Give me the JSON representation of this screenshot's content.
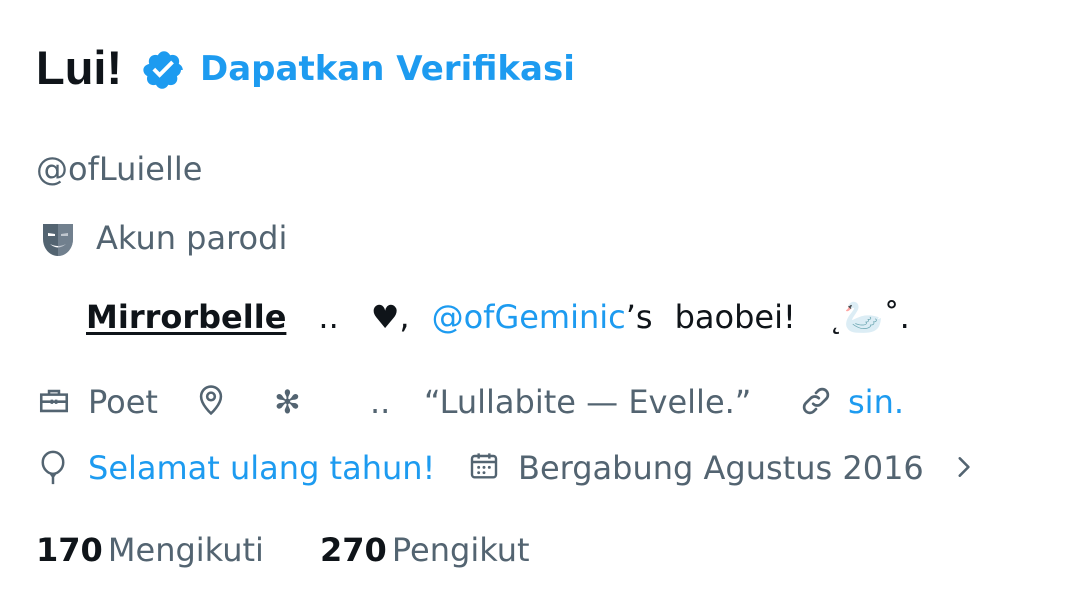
{
  "profile": {
    "display_name": "Lui!",
    "verify_cta": "Dapatkan Verifikasi",
    "handle": "@ofLuielle",
    "parody_label": "Akun parodi"
  },
  "bio": {
    "mirror": "Mirrorbelle",
    "dots1": "..",
    "heart": "♥,",
    "mention": "@ofGeminic",
    "possessive": "’s",
    "baobei": "baobei!",
    "tail_left": "˛",
    "swan": "🦢",
    "tail_right": "˚."
  },
  "meta": {
    "profession": "Poet",
    "location_star": "✻",
    "location_dots": "..",
    "location_quote": "“Lullabite — Evelle.”",
    "website": "sin.",
    "birthday": "Selamat ulang tahun!",
    "joined": "Bergabung Agustus 2016"
  },
  "stats": {
    "following_count": "170",
    "following_label": "Mengikuti",
    "followers_count": "270",
    "followers_label": "Pengikut"
  },
  "colors": {
    "accent": "#1d9bf0",
    "secondary_text": "#536471",
    "primary_text": "#0f1419"
  },
  "icons": {
    "verified": "verified-badge-icon",
    "parody": "theater-mask-icon",
    "profession": "briefcase-icon",
    "location": "map-pin-icon",
    "website": "link-icon",
    "birthday": "balloon-icon",
    "joined": "calendar-icon",
    "more": "chevron-right-icon"
  }
}
